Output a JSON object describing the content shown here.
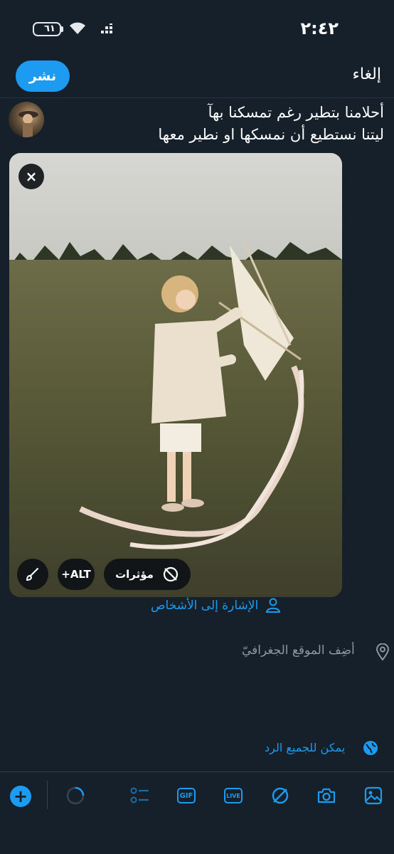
{
  "status_bar": {
    "time": "٢:٤٢",
    "battery": "٦١"
  },
  "header": {
    "cancel_label": "إلغاء",
    "post_label": "نشر"
  },
  "composer": {
    "text": "أحلامنا بتطير رغم تمسكنا بهآ\nليتنا نستطيع أن نمسكها او نطير معها"
  },
  "media": {
    "close_label": "×",
    "alt_label": "+ALT",
    "effects_label": "مؤثرات"
  },
  "options": {
    "tag_people": "الإشارة إلى الأشخاص",
    "add_location": "أضِف الموقع الجغرافيّ",
    "reply_setting": "يمكن للجميع الرد"
  },
  "toolbar": {
    "items": [
      "image-icon",
      "camera-icon",
      "no-effects-icon",
      "live-icon",
      "gif-icon",
      "poll-icon",
      "progress-circle",
      "add-button"
    ],
    "live_label": "LIVE",
    "gif_label": "GIF",
    "add_label": "+"
  },
  "colors": {
    "background": "#15202b",
    "accent": "#1d9bf0",
    "muted": "#8b98a5"
  }
}
